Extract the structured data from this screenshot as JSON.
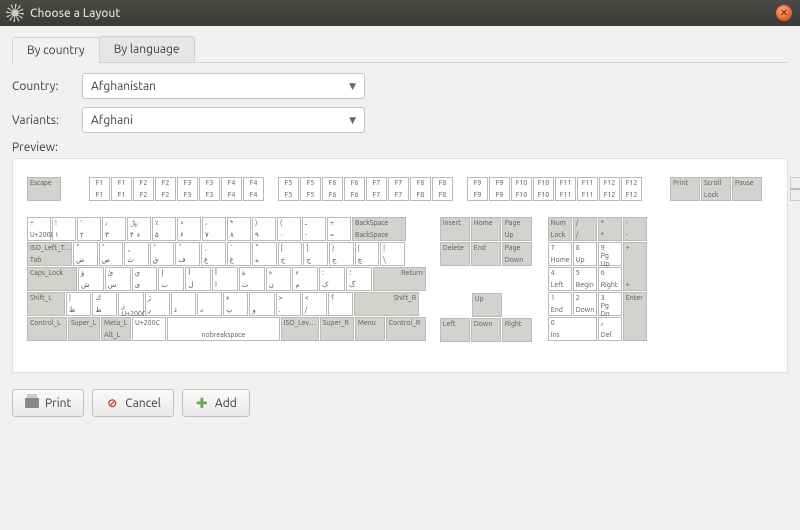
{
  "window": {
    "title": "Choose a Layout"
  },
  "tabs": {
    "by_country": "By country",
    "by_language": "By language"
  },
  "form": {
    "country_label": "Country:",
    "country_value": "Afghanistan",
    "variants_label": "Variants:",
    "variants_value": "Afghani"
  },
  "preview_label": "Preview:",
  "footer": {
    "print": "Print",
    "cancel": "Cancel",
    "add": "Add"
  },
  "fkeys": {
    "esc": "Escape",
    "g1": [
      [
        "F1",
        "F1"
      ],
      [
        "F1",
        "F1"
      ],
      [
        "F2",
        "F2"
      ],
      [
        "F2",
        "F2"
      ],
      [
        "F3",
        "F3"
      ],
      [
        "F3",
        "F3"
      ],
      [
        "F4",
        "F4"
      ],
      [
        "F4",
        "F4"
      ]
    ],
    "g2": [
      [
        "F5",
        "F5"
      ],
      [
        "F5",
        "F5"
      ],
      [
        "F6",
        "F6"
      ],
      [
        "F6",
        "F6"
      ],
      [
        "F7",
        "F7"
      ],
      [
        "F7",
        "F7"
      ],
      [
        "F8",
        "F8"
      ],
      [
        "F8",
        "F8"
      ]
    ],
    "g3": [
      [
        "F9",
        "F9"
      ],
      [
        "F9",
        "F9"
      ],
      [
        "F10",
        "F10"
      ],
      [
        "F10",
        "F10"
      ],
      [
        "F11",
        "F11"
      ],
      [
        "F11",
        "F11"
      ],
      [
        "F12",
        "F12"
      ],
      [
        "F12",
        "F12"
      ]
    ],
    "sys": [
      [
        "Print",
        ""
      ],
      [
        "Scroll",
        "Lock"
      ],
      [
        "Pause",
        ""
      ]
    ]
  },
  "row1": {
    "lead": {
      "top": "÷",
      "sub": "U+200D"
    },
    "keys": [
      {
        "t": "!",
        "b": "۱"
      },
      {
        "t": "٬",
        "b": "۲"
      },
      {
        "t": "٫",
        "b": "۳"
      },
      {
        "t": "﷼",
        "b": "۴ ‎ ء"
      },
      {
        "t": "٪",
        "b": "۵"
      },
      {
        "t": "×",
        "b": "۶"
      },
      {
        "t": "،",
        "b": "۷"
      },
      {
        "t": "*",
        "b": "۸"
      },
      {
        "t": ")",
        "b": "۹"
      },
      {
        "t": "(",
        "b": "۰"
      },
      {
        "t": "ـ",
        "b": "-"
      },
      {
        "t": "+",
        "b": "="
      }
    ],
    "back": {
      "top": "BackSpace",
      "bot": "BackSpace"
    }
  },
  "row2": {
    "lead": {
      "top": "ISO_Left_T…",
      "bot": "Tab"
    },
    "keys": [
      {
        "t": "ْ",
        "b": "ض"
      },
      {
        "t": "ٌ",
        "b": "ص"
      },
      {
        "t": "ٍ",
        "b": "ث"
      },
      {
        "t": "ً",
        "b": "ق"
      },
      {
        "t": "ُ",
        "b": "ف"
      },
      {
        "t": "ِ",
        "b": "غ"
      },
      {
        "t": "َ",
        "b": "ع"
      },
      {
        "t": "ّ",
        "b": "ه"
      },
      {
        "t": "[",
        "b": "خ"
      },
      {
        "t": "]",
        "b": "ح"
      },
      {
        "t": "}",
        "b": "ج"
      },
      {
        "t": "{",
        "b": "چ"
      },
      {
        "t": "|",
        "b": "\\"
      }
    ]
  },
  "row3": {
    "lead": "Caps_Lock",
    "keys": [
      {
        "t": "ؤ",
        "b": "ش"
      },
      {
        "t": "ئ",
        "b": "س"
      },
      {
        "t": "ي",
        "b": "ی"
      },
      {
        "t": "إ",
        "b": "ب"
      },
      {
        "t": "أ",
        "b": "ل"
      },
      {
        "t": "آ",
        "b": "ا"
      },
      {
        "t": "ة",
        "b": "ت"
      },
      {
        "t": "»",
        "b": "ن"
      },
      {
        "t": "«",
        "b": "م"
      },
      {
        "t": ":",
        "b": "ک"
      },
      {
        "t": "؛",
        "b": "گ"
      }
    ],
    "enter": "Return"
  },
  "row4": {
    "lead": "Shift_L",
    "keys": [
      {
        "t": "|",
        "b": "ظ"
      },
      {
        "t": "ك",
        "b": "ط"
      },
      {
        "t": "",
        "b": "ز ‎ U+200C"
      },
      {
        "t": "ژ",
        "b": "ر"
      },
      {
        "t": "",
        "b": "ذ"
      },
      {
        "t": "‌",
        "b": "د"
      },
      {
        "t": "ء",
        "b": "پ"
      },
      {
        "t": "",
        "b": "و"
      },
      {
        "t": ">",
        "b": "."
      },
      {
        "t": "<",
        "b": "/"
      },
      {
        "t": "؟",
        "b": ""
      }
    ],
    "shiftr": "Shift_R"
  },
  "row5": {
    "ctrl_l": "Control_L",
    "super_l": "Super_L",
    "meta_l_top": "Meta_L",
    "meta_l_bot": "Alt_L",
    "zwnj": "U+200C",
    "space": "nobreakspace",
    "iso": "ISO_Lev…",
    "super_r": "Super_R",
    "menu": "Menu",
    "ctrl_r": "Control_R"
  },
  "nav": {
    "r1": [
      "Insert",
      "Home",
      "Page Up"
    ],
    "r2": [
      "Delete",
      "End",
      "Page Down"
    ],
    "up": "Up",
    "left": "Left",
    "down": "Down",
    "right": "Right"
  },
  "numpad": {
    "r1": [
      [
        "Num",
        "Lock"
      ],
      [
        "/",
        "/"
      ],
      [
        "*",
        "*"
      ],
      [
        "-",
        "-"
      ]
    ],
    "r2": [
      [
        "7",
        "Home"
      ],
      [
        "8",
        "Up"
      ],
      [
        "9",
        "Pg Up"
      ]
    ],
    "plus": [
      "+",
      "+"
    ],
    "r3": [
      [
        "4",
        "Left"
      ],
      [
        "5",
        "Begin"
      ],
      [
        "6",
        "Right"
      ]
    ],
    "r4": [
      [
        "1",
        "End"
      ],
      [
        "2",
        "Down"
      ],
      [
        "3",
        "Pg Dn"
      ]
    ],
    "enter": "Enter",
    "r5": [
      [
        "0",
        "Ins"
      ],
      [
        "٫",
        "Del"
      ]
    ]
  }
}
